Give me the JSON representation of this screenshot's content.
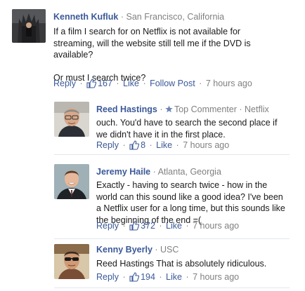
{
  "comments": [
    {
      "author": "Kenneth Kufluk",
      "location": "San Francisco, California",
      "body": [
        "If a film I search for on Netflix is not available for streaming, will the website still tell me if the DVD is available?",
        "Or must I search twice?"
      ],
      "reply_label": "Reply",
      "like_count": "167",
      "like_label": "Like",
      "follow_label": "Follow Post",
      "time": "7 hours ago",
      "avatar_icon": "throne-photo"
    },
    {
      "author": "Reed Hastings",
      "badge": "Top Commenter",
      "org": "Netflix",
      "body": [
        "ouch. You'd have to search the second place if we didn't have it in the first place."
      ],
      "reply_label": "Reply",
      "like_count": "8",
      "like_label": "Like",
      "time": "7 hours ago",
      "avatar_icon": "man-glasses-photo"
    },
    {
      "author": "Jeremy Haile",
      "location": "Atlanta, Georgia",
      "body": [
        "Exactly - having to search twice - how in the world can this sound like a good idea? I've been a Netflix user for a long time, but this sounds like the beginning of the end =("
      ],
      "reply_label": "Reply",
      "like_count": "372",
      "like_label": "Like",
      "time": "7 hours ago",
      "avatar_icon": "man-suit-photo"
    },
    {
      "author": "Kenny Byerly",
      "location": "USC",
      "body": [
        "Reed Hastings That is absolutely ridiculous."
      ],
      "reply_label": "Reply",
      "like_count": "194",
      "like_label": "Like",
      "time": "7 hours ago",
      "avatar_icon": "man-sunglasses-photo"
    }
  ],
  "colors": {
    "link": "#3b5998",
    "muted": "#808080",
    "divider": "#e3e6ee"
  }
}
